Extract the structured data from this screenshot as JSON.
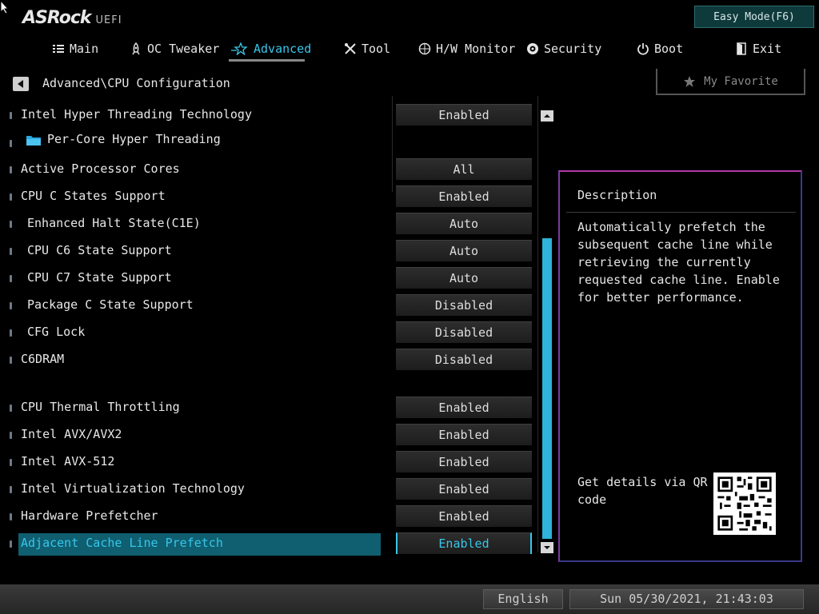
{
  "brand": {
    "logo_main": "ASRock",
    "logo_sub": "UEFI"
  },
  "mode_button": "Easy Mode(F6)",
  "tabs": [
    {
      "label": "Main",
      "icon": "list-icon"
    },
    {
      "label": "OC Tweaker",
      "icon": "rocket-icon"
    },
    {
      "label": "Advanced",
      "icon": "star-icon",
      "active": true
    },
    {
      "label": "Tool",
      "icon": "wrench-icon"
    },
    {
      "label": "H/W Monitor",
      "icon": "monitor-icon"
    },
    {
      "label": "Security",
      "icon": "shield-icon"
    },
    {
      "label": "Boot",
      "icon": "power-icon"
    },
    {
      "label": "Exit",
      "icon": "exit-icon"
    }
  ],
  "breadcrumb": "Advanced\\CPU Configuration",
  "favorite_label": "My Favorite",
  "settings": [
    {
      "label": "Intel Hyper Threading Technology",
      "value": "Enabled"
    },
    {
      "label": "Per-Core Hyper Threading",
      "value": "",
      "folder": true
    },
    {
      "label": "Active Processor Cores",
      "value": "All"
    },
    {
      "label": "CPU C States Support",
      "value": "Enabled"
    },
    {
      "label": "Enhanced Halt State(C1E)",
      "value": "Auto"
    },
    {
      "label": "CPU C6 State Support",
      "value": "Auto"
    },
    {
      "label": "CPU C7 State Support",
      "value": "Auto"
    },
    {
      "label": "Package C State Support",
      "value": "Disabled"
    },
    {
      "label": "CFG Lock",
      "value": "Disabled"
    },
    {
      "label": "C6DRAM",
      "value": "Disabled"
    },
    {
      "label": "CPU Thermal Throttling",
      "value": "Enabled"
    },
    {
      "label": "Intel AVX/AVX2",
      "value": "Enabled"
    },
    {
      "label": "Intel AVX-512",
      "value": "Enabled"
    },
    {
      "label": "Intel Virtualization Technology",
      "value": "Enabled"
    },
    {
      "label": "Hardware Prefetcher",
      "value": "Enabled"
    },
    {
      "label": "Adjacent Cache Line Prefetch",
      "value": "Enabled",
      "selected": true
    }
  ],
  "description": {
    "title": "Description",
    "text": "Automatically prefetch the subsequent cache line while retrieving the currently requested cache line. Enable for better performance.",
    "qr_text": "Get details via QR code"
  },
  "footer": {
    "language": "English",
    "datetime": "Sun 05/30/2021, 21:43:03"
  },
  "colors": {
    "accent": "#38c6ea",
    "highlight": "#0f5f70"
  }
}
